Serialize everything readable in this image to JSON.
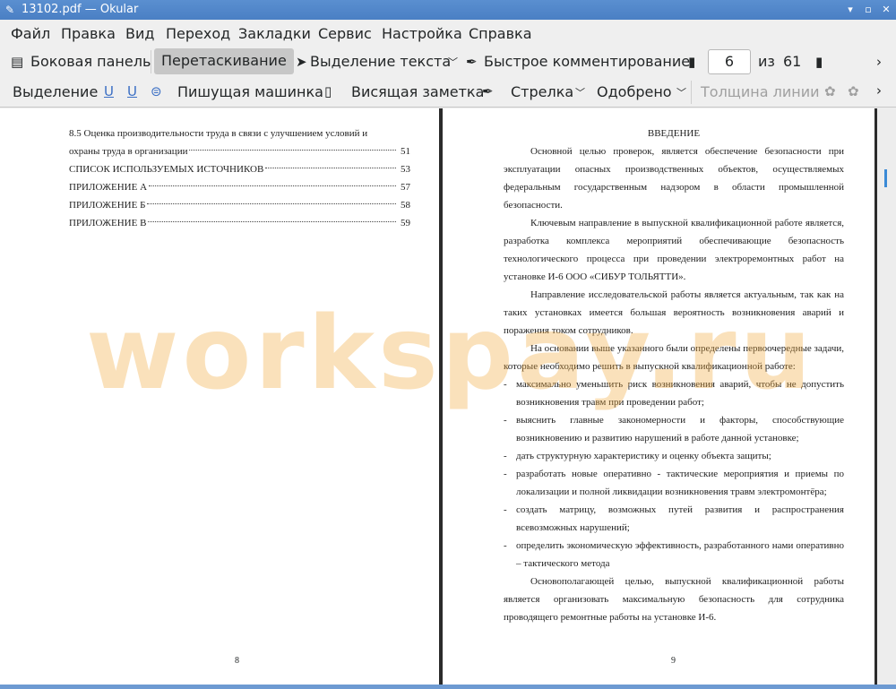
{
  "window": {
    "title": "13102.pdf — Okular"
  },
  "menu": [
    "Файл",
    "Правка",
    "Вид",
    "Переход",
    "Закладки",
    "Сервис",
    "Настройка",
    "Справка"
  ],
  "toolbar1": {
    "sidebar": "Боковая панель",
    "drag": "Перетаскивание",
    "text_select": "Выделение текста",
    "quick_comment": "Быстрое комментирование",
    "page_current": "6",
    "page_of": "из",
    "page_total": "61"
  },
  "toolbar2": {
    "highlight": "Выделение",
    "typewriter": "Пишущая машинка",
    "note": "Висящая заметка",
    "arrow": "Стрелка",
    "stamp": "Одобрено",
    "line_width": "Толщина линии"
  },
  "left_page": {
    "toc": [
      {
        "text": "8.5 Оценка производительности труда в связи с улучшением условий и",
        "page": ""
      },
      {
        "text": "охраны труда в организации",
        "page": "51"
      },
      {
        "text": "СПИСОК ИСПОЛЬЗУЕМЫХ ИСТОЧНИКОВ",
        "page": "53"
      },
      {
        "text": "ПРИЛОЖЕНИЕ А",
        "page": "57"
      },
      {
        "text": "ПРИЛОЖЕНИЕ Б",
        "page": "58"
      },
      {
        "text": "ПРИЛОЖЕНИЕ В",
        "page": "59"
      }
    ],
    "page_number": "8"
  },
  "right_page": {
    "heading": "ВВЕДЕНИЕ",
    "para1": "Основной целью проверок, является обеспечение безопасности при эксплуатации опасных производственных объектов, осуществляемых федеральным государственным надзором в области промышленной безопасности.",
    "para2": "Ключевым направление в выпускной квалификационной работе является, разработка комплекса мероприятий обеспечивающие безопасность технологического процесса при проведении электроремонтных работ на установке И-6  ООО «СИБУР ТОЛЬЯТТИ».",
    "para3": "Направление исследовательской работы является актуальным, так как на таких установках имеется большая вероятность возникновения аварий и поражения током сотрудников.",
    "para4": "На основании выше указанного были определены первоочередные задачи, которые необходимо решить в выпускной квалификационной работе:",
    "bullets": [
      "максимально уменьшить риск возникновения аварий, чтобы не допустить возникновения травм при проведении работ;",
      "выяснить главные закономерности и факторы, способствующие возникновению и развитию нарушений в работе данной установке;",
      "дать структурную характеристику и оценку объекта защиты;",
      "разработать новые оперативно - тактические мероприятия и приемы по локализации и полной ликвидации возникновения травм электромонтёра;",
      "создать матрицу, возможных путей развития и распространения всевозможных нарушений;",
      "определить экономическую эффективность, разработанного нами оперативно – тактического метода"
    ],
    "para5": "Основополагающей целью, выпускной квалификационной работы является организовать максимальную безопасность для сотрудника проводящего ремонтные работы на установке И-6.",
    "page_number": "9"
  },
  "watermark": "workspay.ru",
  "colors": {
    "titlebar": "#4a7fc4",
    "watermark": "#f0aa3c",
    "active_button": "#c7c7c7"
  }
}
